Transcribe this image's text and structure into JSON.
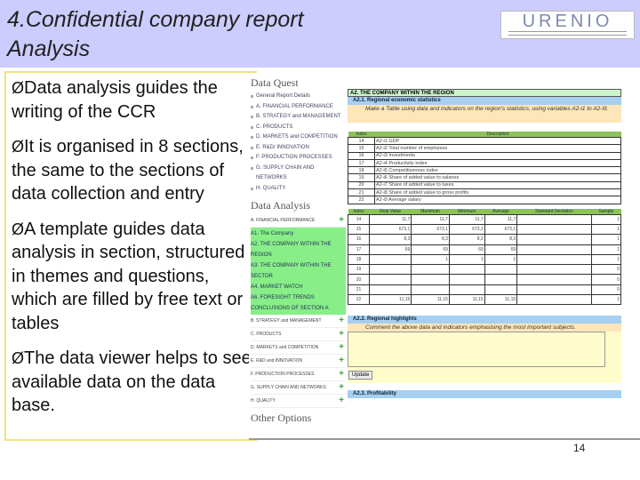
{
  "slide": {
    "title": "4.Confidential company report Analysis",
    "logo": "URENIO",
    "page_number": "14",
    "bullets": [
      "Data analysis guides the writing of the CCR",
      "It is organised in 8 sections, the same to the sections of data collection and entry",
      "A template guides data analysis in section, structured in themes and questions, which are filled by free text or tables",
      "The data viewer helps to see available data on the data base."
    ]
  },
  "app": {
    "data_quest": {
      "heading": "Data Quest",
      "items": [
        "General Report Details",
        "A. FINANCIAL PERFORMANCE",
        "B. STRATEGY and MANAGEMENT",
        "C. PRODUCTS",
        "D. MARKETS and COMPETITION",
        "E. R&D/ INNOVATION",
        "F. PRODUCTION PROCESSES",
        "G. SUPPLY CHAIN AND NETWORKS",
        "H. QUALITY"
      ]
    },
    "data_analysis": {
      "heading": "Data Analysis",
      "open_section": "A. FINANCIAL PERFORMANCE",
      "sub_items": [
        "A1. The Company",
        "A2. THE COMPANY WITHIN THE REGION",
        "A3. THE COMPANY WITHIN THE SECTOR",
        "A4. MARKET WATCH",
        "A6. FORESIGHT TRENDS",
        "CONCLUSIONS OF SECTION A"
      ],
      "sections": [
        "B. STRATEGY and MANAGEMENT",
        "C. PRODUCTS",
        "D. MARKETS and COMPETITION",
        "E. R&D and INNOVATION",
        "F. PRODUCTION PROCESSES",
        "G. SUPPLY CHAIN AND NETWORKS",
        "H. QUALITY"
      ]
    },
    "other_options": "Other Options",
    "main": {
      "section": "A2. THE COMPANY WITHIN THE REGION",
      "sub1": "A2.1. Regional economic statistics",
      "instr1": "Make a Table using data and indicators on the region's statistics, using variables A2-i1 to A2-i9.",
      "var_headers": [
        "Index",
        "Description"
      ],
      "vars": [
        [
          "14",
          "A2-i1 GDP"
        ],
        [
          "15",
          "A2-i2 Total number of employees"
        ],
        [
          "16",
          "A2-i3 Investments"
        ],
        [
          "17",
          "A2-i4 Productivity index"
        ],
        [
          "18",
          "A2-i5 Competitiveness index"
        ],
        [
          "19",
          "A2-i6 Share of added value to salaries"
        ],
        [
          "20",
          "A2-i7 Share of added value to taxes"
        ],
        [
          "21",
          "A2-i8 Share of added value to gross profits"
        ],
        [
          "22",
          "A2-i9 Average salary"
        ]
      ],
      "stat_headers": [
        "Index",
        "Real Value",
        "Maximum",
        "Minimum",
        "Average",
        "Standard Deviation",
        "Sample"
      ],
      "stats": [
        [
          "14",
          "11,7",
          "11,7",
          "11,7",
          "11,7",
          "",
          "1"
        ],
        [
          "15",
          "673,1",
          "673,1",
          "673,1",
          "673,1",
          "",
          "1"
        ],
        [
          "16",
          "8,3",
          "8,3",
          "8,3",
          "8,3",
          "",
          "1"
        ],
        [
          "17",
          "69",
          "69",
          "69",
          "69",
          "",
          "1"
        ],
        [
          "18",
          "",
          "1",
          "1",
          "1",
          "",
          "1"
        ],
        [
          "19",
          "",
          "",
          "",
          "",
          "",
          "0"
        ],
        [
          "20",
          "",
          "",
          "",
          "",
          "",
          "0"
        ],
        [
          "21",
          "",
          "",
          "",
          "",
          "",
          "0"
        ],
        [
          "22",
          "11,15",
          "11,15",
          "11,15",
          "11,15",
          "",
          "1"
        ]
      ],
      "sub2": "A2.2. Regional highlights",
      "instr2": "Comment the above data and indicators emphasising the most important subjects.",
      "update": "Update",
      "sub3": "A2.3. Profitability"
    }
  }
}
